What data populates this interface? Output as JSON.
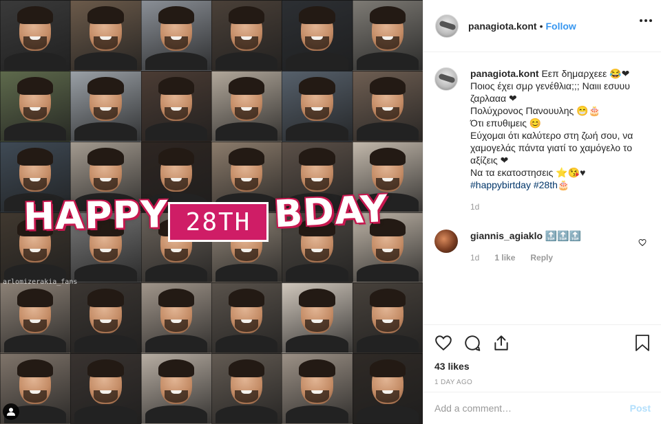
{
  "post": {
    "banner_word_1": "HAPPY",
    "banner_number": "28TH",
    "banner_word_2": "BDAY",
    "watermark": "arlomizerakia_fans"
  },
  "header": {
    "username": "panagiota.kont",
    "separator": "•",
    "follow_label": "Follow"
  },
  "caption": {
    "username": "panagiota.kont",
    "lines": [
      " Εεπ δημαρχεεε 😂❤",
      "Ποιος έχει σμρ γενέθλια;;; Ναιιι εσυυυ ζαρλααα ❤",
      "Πολύχρονος Πανουυλης 😁🎂",
      "Ότι επυθιμεις 😊",
      "Εύχομαι ότι καλύτερο στη ζωή σου, να χαμογελάς πάντα γιατί το χαμόγελο το αξίζεις ❤",
      "Να τα εκατοστησεις ⭐😘♥"
    ],
    "hashtags": "#happybirtday #28th🎂",
    "time": "1d"
  },
  "reply": {
    "username": "giannis_agiaklo",
    "text": " 🔝🔝🔝",
    "time": "1d",
    "likes": "1 like",
    "reply_label": "Reply"
  },
  "stats": {
    "likes": "43 likes",
    "date": "1 DAY AGO"
  },
  "comment_box": {
    "placeholder": "Add a comment…",
    "post_label": "Post"
  },
  "colors": {
    "accent": "#3897f0",
    "banner_pink": "#cf1d66",
    "post_disabled": "#b2dffc"
  }
}
